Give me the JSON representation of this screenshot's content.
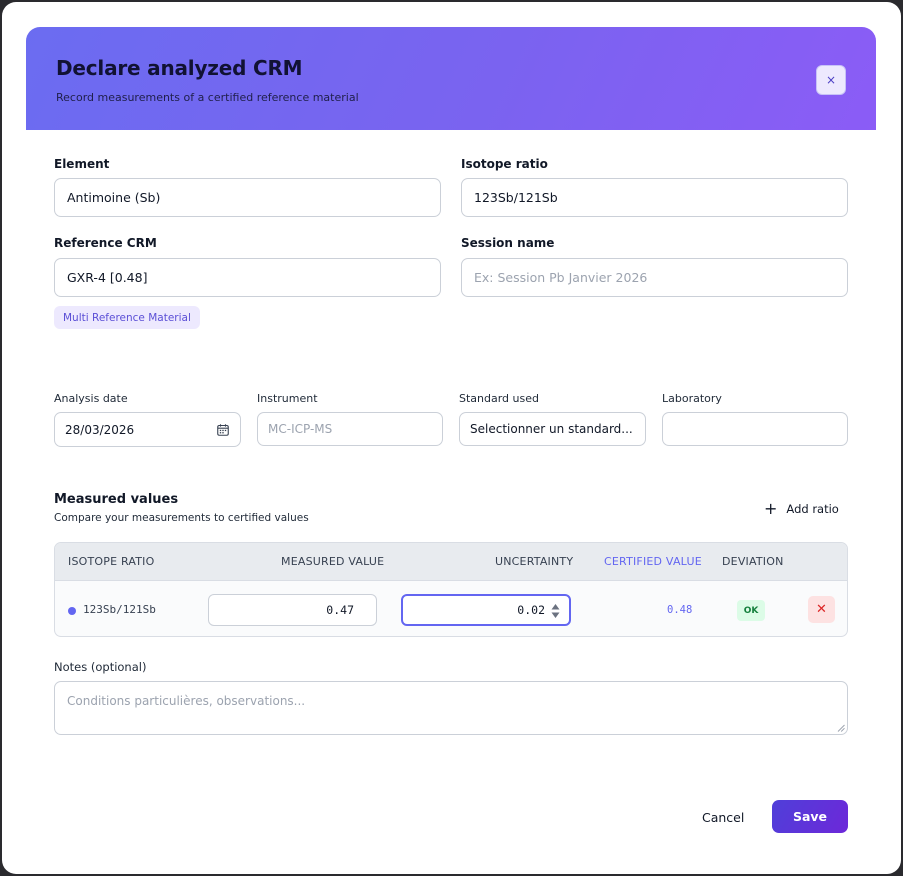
{
  "dialog": {
    "title": "Declare analyzed CRM",
    "subtitle": "Record measurements of a certified reference material",
    "close_label": "×"
  },
  "form": {
    "element": {
      "label": "Element",
      "value": "Antimoine (Sb)"
    },
    "isotope_ratio": {
      "label": "Isotope ratio",
      "value": "123Sb/121Sb"
    },
    "reference_crm": {
      "label": "Reference CRM",
      "value": "GXR-4 [0.48]",
      "tag": "Multi  Reference Material"
    },
    "session_name": {
      "label": "Session name",
      "placeholder": "Ex: Session Pb Janvier 2026"
    },
    "analysis_date": {
      "label": "Analysis date",
      "value": "28/03/2026"
    },
    "instrument": {
      "label": "Instrument",
      "placeholder": "MC-ICP-MS"
    },
    "standard_used": {
      "label": "Standard used",
      "value": "Selectionner un standard..."
    },
    "laboratory": {
      "label": "Laboratory",
      "value": ""
    }
  },
  "measured": {
    "title": "Measured values",
    "subtitle": "Compare your measurements to certified values",
    "add_label": "Add ratio",
    "columns": [
      "ISOTOPE RATIO",
      "MEASURED VALUE",
      "UNCERTAINTY",
      "CERTIFIED VALUE",
      "DEVIATION"
    ],
    "rows": [
      {
        "ratio": "123Sb/121Sb",
        "measured": "0.47",
        "uncertainty": "0.02",
        "certified": "0.48",
        "deviation": "OK",
        "remove": "✕"
      }
    ]
  },
  "notes": {
    "label": "Notes (optional)",
    "placeholder": "Conditions particulières, observations..."
  },
  "footer": {
    "cancel": "Cancel",
    "save": "Save"
  },
  "colors": {
    "accent": "#6366f1",
    "header_start": "#6b6cf1",
    "header_end": "#8b5cf6",
    "ok": "#15803d",
    "danger": "#dc2626"
  }
}
